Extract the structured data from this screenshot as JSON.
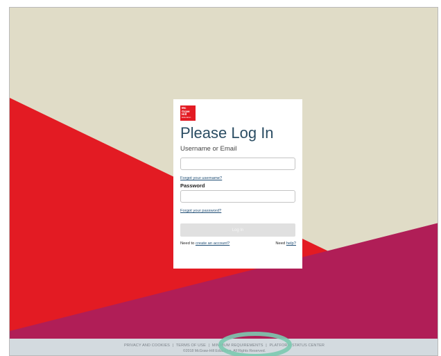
{
  "brand": {
    "logo_lines": [
      "Mc",
      "Graw",
      "Hill"
    ],
    "logo_sub": "Education"
  },
  "login": {
    "title": "Please Log In",
    "username_label": "Username or Email",
    "username_value": "",
    "forgot_username": "Forgot your username?",
    "password_label": "Password",
    "password_value": "",
    "forgot_password": "Forgot your password?",
    "login_button": "Log In",
    "need_to": "Need to",
    "create_account": "create an account?",
    "need": "Need",
    "help": "help?"
  },
  "footer": {
    "links": [
      "PRIVACY AND COOKIES",
      "TERMS OF USE",
      "MINIMUM REQUIREMENTS",
      "PLATFORM STATUS CENTER"
    ],
    "separator": "|",
    "copyright": "©2018 McGraw-Hill Education. All Rights Reserved."
  },
  "colors": {
    "background_tan": "#e0dcc7",
    "red": "#e31b23",
    "magenta": "#b01e57",
    "footer_bg": "#d3dadf",
    "highlight": "#7cc9b0"
  }
}
